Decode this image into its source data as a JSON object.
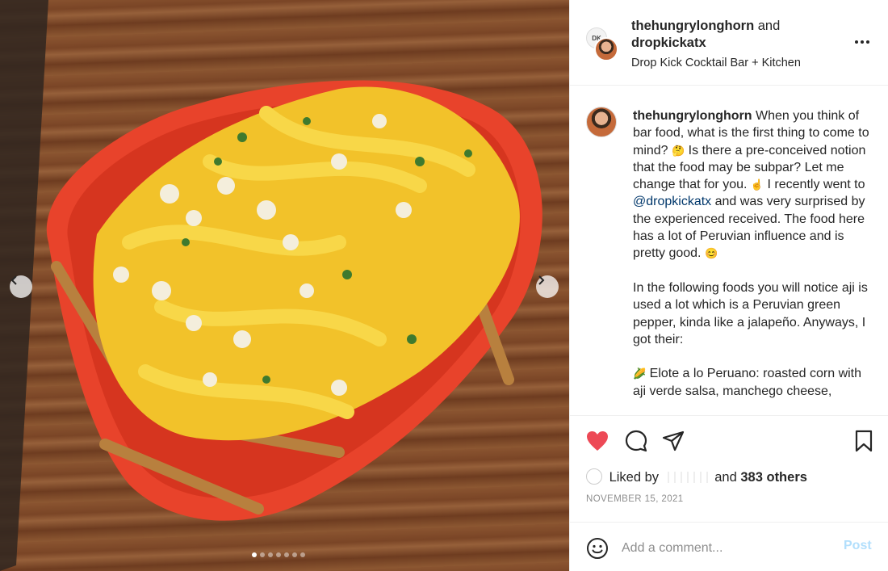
{
  "post": {
    "owner": "thehungrylonghorn",
    "joiner": "and",
    "collaborator": "dropkickatx",
    "location": "Drop Kick Cocktail Bar + Kitchen",
    "collab_badge_text": "DK"
  },
  "caption": {
    "author": "thehungrylonghorn",
    "p1_a": "When you think of bar food, what is the first thing to come to mind?",
    "p1_b": "Is there a pre-conceived notion that the food may be subpar? Let me change that for you.",
    "p1_c": "I recently went to",
    "mention": "@dropkickatx",
    "p1_d": "and was very surprised by the experienced received. The food here has a lot of Peruvian influence and is pretty good.",
    "p2": "In the following foods you will notice aji is used a lot which is a Peruvian green pepper, kinda like a jalapeño. Anyways, I got their:",
    "p3": "Elote a lo Peruano: roasted corn with aji verde salsa, manchego cheese,",
    "emoji_think": "🤔",
    "emoji_point": "☝️",
    "emoji_smile": "😊",
    "emoji_corn": "🌽"
  },
  "actions": {
    "like_icon": "heart-icon",
    "comment_icon": "comment-icon",
    "share_icon": "share-icon",
    "save_icon": "bookmark-icon",
    "liked": true
  },
  "likes": {
    "prefix": "Liked by",
    "joiner": "and",
    "others": "383 others"
  },
  "date": "NOVEMBER 15, 2021",
  "comment": {
    "placeholder": "Add a comment...",
    "post_label": "Post"
  },
  "carousel": {
    "slides": 7,
    "active_index": 0
  },
  "colors": {
    "like_red": "#ed4956",
    "post_button_disabled": "#b2dffc",
    "mention_blue": "#00376b"
  }
}
